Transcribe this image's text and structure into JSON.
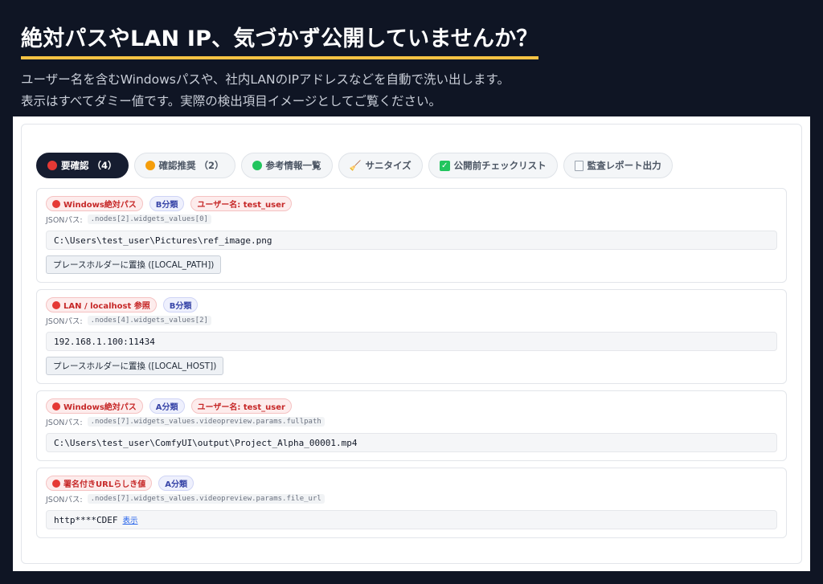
{
  "hero": {
    "title": "絶対パスやLAN IP、気づかず公開していませんか？",
    "sub1": "ユーザー名を含むWindowsパスや、社内LANのIPアドレスなどを自動で洗い出します。",
    "sub2": "表示はすべてダミー値です。実際の検出項目イメージとしてご覧ください。"
  },
  "tabs": [
    {
      "label": "要確認 （4）",
      "icon": "red-dot"
    },
    {
      "label": "確認推奨 （2）",
      "icon": "orange-dot"
    },
    {
      "label": "参考情報一覧",
      "icon": "green-dot"
    },
    {
      "label": "サニタイズ",
      "icon": "broom-icon"
    },
    {
      "label": "公開前チェックリスト",
      "icon": "check-icon"
    },
    {
      "label": "監査レポート出力",
      "icon": "document-icon"
    }
  ],
  "path_prefix": "JSONパス:",
  "items": [
    {
      "badges": [
        "Windows絶対パス",
        "B分類",
        "ユーザー名: test_user"
      ],
      "json_path": ".nodes[2].widgets_values[0]",
      "value": "C:\\Users\\test_user\\Pictures\\ref_image.png",
      "button": "プレースホルダーに置換 ([LOCAL_PATH])"
    },
    {
      "badges": [
        "LAN / localhost 参照",
        "B分類"
      ],
      "json_path": ".nodes[4].widgets_values[2]",
      "value": "192.168.1.100:11434",
      "button": "プレースホルダーに置換 ([LOCAL_HOST])"
    },
    {
      "badges": [
        "Windows絶対パス",
        "A分類",
        "ユーザー名: test_user"
      ],
      "json_path": ".nodes[7].widgets_values.videopreview.params.fullpath",
      "value": "C:\\Users\\test_user\\ComfyUI\\output\\Project_Alpha_00001.mp4"
    },
    {
      "badges": [
        "署名付きURLらしき値",
        "A分類"
      ],
      "json_path": ".nodes[7].widgets_values.videopreview.params.file_url",
      "value": "http****CDEF",
      "link": "表示"
    }
  ],
  "colors": {
    "background": "#0f1524",
    "accent_underline": "#f6c344",
    "active_tab": "#161d30",
    "alert_red": "#c62828",
    "class_blue": "#3946a8"
  }
}
